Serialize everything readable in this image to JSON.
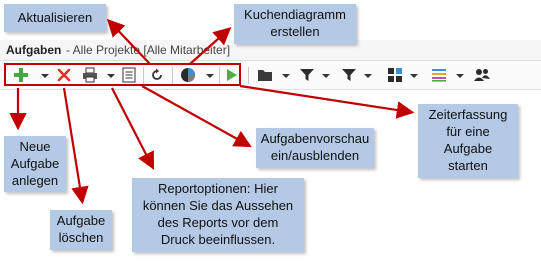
{
  "window": {
    "title_bold": "Aufgaben",
    "title_rest": " - Alle Projekte [Alle Mitarbeiter]"
  },
  "toolbar": {
    "icons": [
      "add-icon",
      "delete-icon",
      "print-icon",
      "report-options-icon",
      "refresh-icon",
      "pie-chart-icon",
      "play-icon",
      "folder-icon",
      "filter-icon",
      "filter-icon",
      "group-icon",
      "list-icon",
      "users-icon"
    ]
  },
  "callouts": {
    "aktualisieren": "Aktualisieren",
    "kuchendiagramm": "Kuchendiagramm\nerstellen",
    "zeiterfassung": "Zeiterfassung\nfür eine\nAufgabe\nstarten",
    "aufgabenvorschau": "Aufgabenvorschau\nein/ausblenden",
    "neue_aufgabe": "Neue\nAufgabe\nanlegen",
    "reportoptionen": "Reportoptionen: Hier\nkönnen Sie das Aussehen\ndes Reports vor dem\nDruck beeinflussen.",
    "aufgabe_loeschen": "Aufgabe\nlöschen"
  },
  "colors": {
    "callout_bg": "#b3c9e5",
    "arrow": "#c00000",
    "highlight_border": "#c00000"
  }
}
